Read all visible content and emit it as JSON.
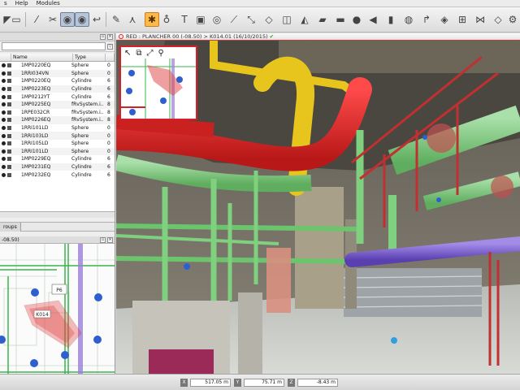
{
  "menu": {
    "items": [
      "s",
      "Help",
      "Modules"
    ]
  },
  "toolbar": {
    "icons": [
      "pointer-icon",
      "screen-icon",
      "wand-icon",
      "scissors-icon",
      "eye-icon",
      "eye-filled-icon",
      "hook-icon",
      "pen-icon",
      "tripod-icon",
      "move-icon",
      "orange-star-icon",
      "pin-icon",
      "text-icon",
      "camera-icon",
      "circle-target-icon",
      "line-icon",
      "diagonal-icon",
      "polygon-icon",
      "box-icon",
      "sweep-icon",
      "flat-box-icon",
      "pipe-icon",
      "sphere-icon",
      "cone-icon",
      "cylinder-icon",
      "torus-icon",
      "elbow-icon"
    ]
  },
  "objects": {
    "columns": [
      "Name",
      "Type"
    ],
    "rows": [
      {
        "name": "1MP0220EQ",
        "type": "Sphere",
        "extra": "0"
      },
      {
        "name": "1RRI034VN",
        "type": "Sphere",
        "extra": "0"
      },
      {
        "name": "1MP0220EQ",
        "type": "Cylindre",
        "extra": "6"
      },
      {
        "name": "1MP0223EQ",
        "type": "Cylindre",
        "extra": "6"
      },
      {
        "name": "1MP0212YT",
        "type": "Cylindre",
        "extra": "6"
      },
      {
        "name": "1MP0225EQ",
        "type": "fRvSystem.i..",
        "extra": "8"
      },
      {
        "name": "1RPE032CR",
        "type": "fRvSystem.i..",
        "extra": "8"
      },
      {
        "name": "1MP0226EQ",
        "type": "fRvSystem.i..",
        "extra": "8"
      },
      {
        "name": "1RRI101LD",
        "type": "Sphere",
        "extra": "0"
      },
      {
        "name": "1RRI103LD",
        "type": "Sphere",
        "extra": "0"
      },
      {
        "name": "1RRI105LD",
        "type": "Sphere",
        "extra": "0"
      },
      {
        "name": "1RRI101LD",
        "type": "Sphere",
        "extra": "0"
      },
      {
        "name": "1MP0229EQ",
        "type": "Cylindre",
        "extra": "6"
      },
      {
        "name": "1MP0231EQ",
        "type": "Cylindre",
        "extra": "6"
      },
      {
        "name": "1MP0232EQ",
        "type": "Cylindre",
        "extra": "6"
      }
    ]
  },
  "panels": {
    "groups_tab": "roups",
    "map_title": "-08.50)",
    "map_labels": {
      "p6": "P6",
      "k014": "K014"
    }
  },
  "view": {
    "title": "RED : PLANCHER 00 (-08.50) > K014.01 (16/10/2015)",
    "check": "✔"
  },
  "status": {
    "x_label": "X",
    "x_value": "517.05 m",
    "y_label": "Y",
    "y_value": "75.71 m",
    "z_label": "Z",
    "z_value": "-8.43 m"
  },
  "colors": {
    "accent_red": "#d51f2a",
    "active_tool": "#ffb84a"
  }
}
